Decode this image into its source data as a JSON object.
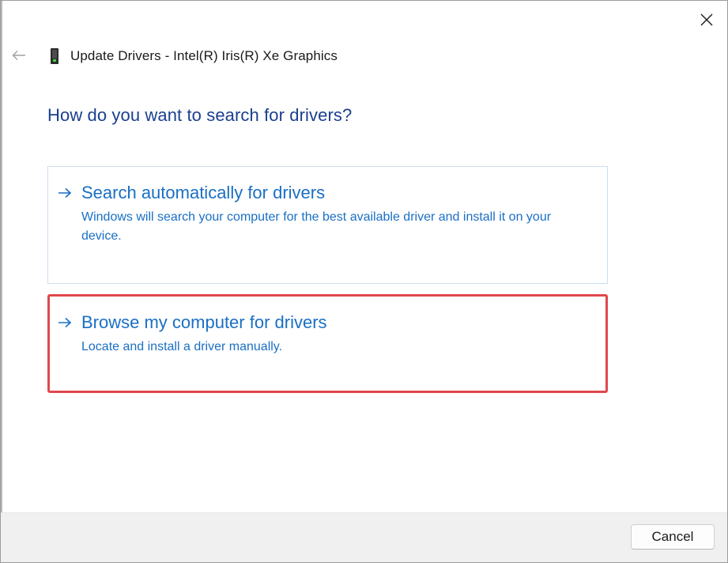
{
  "window": {
    "title": "Update Drivers - Intel(R) Iris(R) Xe Graphics",
    "icons": {
      "close": "close-icon",
      "back": "back-arrow-icon",
      "device": "display-adapter-icon"
    }
  },
  "main": {
    "question": "How do you want to search for drivers?",
    "options": [
      {
        "title": "Search automatically for drivers",
        "description": "Windows will search your computer for the best available driver and install it on your device.",
        "icon": "arrow-right-icon",
        "highlighted": false
      },
      {
        "title": "Browse my computer for drivers",
        "description": "Locate and install a driver manually.",
        "icon": "arrow-right-icon",
        "highlighted": true
      }
    ]
  },
  "footer": {
    "cancel_label": "Cancel"
  },
  "colors": {
    "question_text": "#1b3f8f",
    "link_text": "#1a6fc4",
    "highlight_border": "#e0474c",
    "option_border": "#c9dff2",
    "footer_bg": "#f0f0f0"
  }
}
